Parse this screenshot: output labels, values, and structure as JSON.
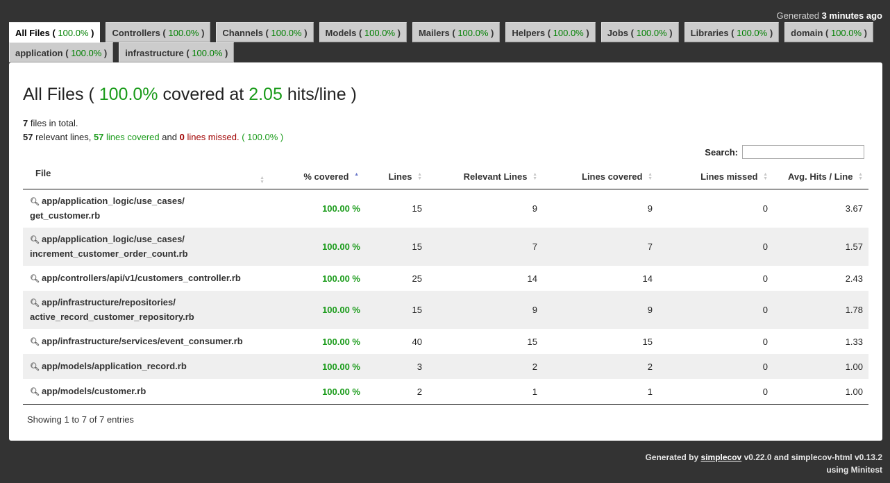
{
  "header": {
    "generated_prefix": "Generated",
    "generated_when": "3 minutes ago"
  },
  "tabs": [
    {
      "name": "All Files",
      "pct": "100.0%",
      "active": true
    },
    {
      "name": "Controllers",
      "pct": "100.0%"
    },
    {
      "name": "Channels",
      "pct": "100.0%"
    },
    {
      "name": "Models",
      "pct": "100.0%"
    },
    {
      "name": "Mailers",
      "pct": "100.0%"
    },
    {
      "name": "Helpers",
      "pct": "100.0%"
    },
    {
      "name": "Jobs",
      "pct": "100.0%"
    },
    {
      "name": "Libraries",
      "pct": "100.0%"
    },
    {
      "name": "domain",
      "pct": "100.0%"
    },
    {
      "name": "application",
      "pct": "100.0%"
    },
    {
      "name": "infrastructure",
      "pct": "100.0%"
    }
  ],
  "summary": {
    "title_prefix": "All Files (",
    "covered_pct": "100.0%",
    "covered_at": "covered at",
    "hits": "2.05",
    "hits_suffix": "hits/line )",
    "files_count": "7",
    "files_text": "files in total.",
    "relevant_lines": "57",
    "relevant_text": "relevant lines,",
    "covered_lines": "57",
    "covered_text": "lines covered",
    "and_text": "and",
    "missed_lines": "0",
    "missed_text": "lines missed.",
    "pct_paren": "( 100.0% )"
  },
  "search": {
    "label": "Search:",
    "value": ""
  },
  "table": {
    "columns": [
      "File",
      "% covered",
      "Lines",
      "Relevant Lines",
      "Lines covered",
      "Lines missed",
      "Avg. Hits / Line"
    ],
    "rows": [
      {
        "file_line1": "app/application_logic/use_cases/",
        "file_line2": "get_customer.rb",
        "covered": "100.00 %",
        "lines": "15",
        "relevant": "9",
        "lines_covered": "9",
        "missed": "0",
        "avg": "3.67"
      },
      {
        "file_line1": "app/application_logic/use_cases/",
        "file_line2": "increment_customer_order_count.rb",
        "covered": "100.00 %",
        "lines": "15",
        "relevant": "7",
        "lines_covered": "7",
        "missed": "0",
        "avg": "1.57"
      },
      {
        "file_line1": "app/controllers/api/v1/customers_controller.rb",
        "file_line2": "",
        "covered": "100.00 %",
        "lines": "25",
        "relevant": "14",
        "lines_covered": "14",
        "missed": "0",
        "avg": "2.43"
      },
      {
        "file_line1": "app/infrastructure/repositories/",
        "file_line2": "active_record_customer_repository.rb",
        "covered": "100.00 %",
        "lines": "15",
        "relevant": "9",
        "lines_covered": "9",
        "missed": "0",
        "avg": "1.78"
      },
      {
        "file_line1": "app/infrastructure/services/event_consumer.rb",
        "file_line2": "",
        "covered": "100.00 %",
        "lines": "40",
        "relevant": "15",
        "lines_covered": "15",
        "missed": "0",
        "avg": "1.33"
      },
      {
        "file_line1": "app/models/application_record.rb",
        "file_line2": "",
        "covered": "100.00 %",
        "lines": "3",
        "relevant": "2",
        "lines_covered": "2",
        "missed": "0",
        "avg": "1.00"
      },
      {
        "file_line1": "app/models/customer.rb",
        "file_line2": "",
        "covered": "100.00 %",
        "lines": "2",
        "relevant": "1",
        "lines_covered": "1",
        "missed": "0",
        "avg": "1.00"
      }
    ],
    "showing": "Showing 1 to 7 of 7 entries"
  },
  "footer": {
    "generated_by": "Generated by",
    "simplecov_link": "simplecov",
    "versions": "v0.22.0 and simplecov-html v0.13.2",
    "using": "using Minitest"
  }
}
